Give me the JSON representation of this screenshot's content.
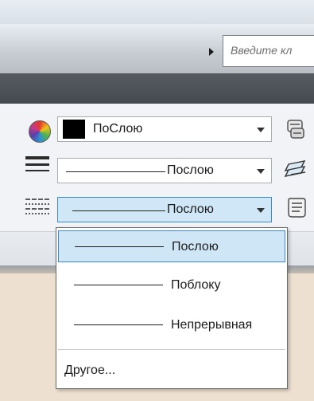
{
  "search": {
    "placeholder": "Введите кл"
  },
  "properties": {
    "color": {
      "value": "ПоСлою",
      "swatch_color": "#000000",
      "icon": "color-wheel-icon"
    },
    "lineweight": {
      "value": "Послою",
      "icon": "lineweight-icon"
    },
    "linetype": {
      "value": "Послою",
      "icon": "linetype-icon",
      "open": true
    }
  },
  "linetype_dropdown": {
    "options": [
      {
        "label": "Послою",
        "selected": true
      },
      {
        "label": "Поблоку",
        "selected": false
      },
      {
        "label": "Непрерывная",
        "selected": false
      }
    ],
    "other_label": "Другое..."
  },
  "colors": {
    "selection_bg": "#cfe6f6",
    "selection_border": "#3a8ad2",
    "dark_bar": "#4b5056",
    "workspace": "#ede0d0"
  }
}
